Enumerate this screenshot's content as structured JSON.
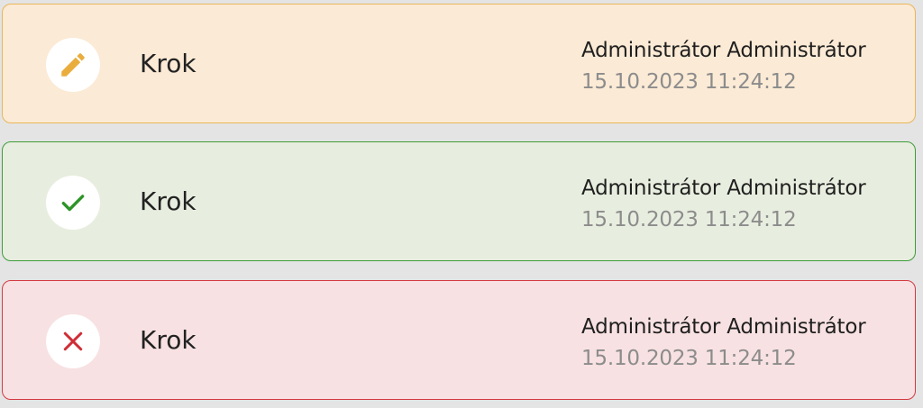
{
  "colors": {
    "page_background": "#e4e4e4",
    "edited": {
      "background": "#fbead5",
      "border": "#e8b65a",
      "icon": "#e9ad3e"
    },
    "approved": {
      "background": "#e8eedf",
      "border": "#3f9b3a",
      "icon": "#2e9428"
    },
    "rejected": {
      "background": "#f8e1e2",
      "border": "#d33a43",
      "icon": "#cf2d36"
    },
    "date_text": "#8c8c8c"
  },
  "steps": [
    {
      "status": "edited",
      "icon": "pencil-icon",
      "title": "Krok",
      "author": "Administrátor Administrátor",
      "datetime": "15.10.2023 11:24:12"
    },
    {
      "status": "approved",
      "icon": "checkmark-icon",
      "title": "Krok",
      "author": "Administrátor Administrátor",
      "datetime": "15.10.2023 11:24:12"
    },
    {
      "status": "rejected",
      "icon": "cross-icon",
      "title": "Krok",
      "author": "Administrátor Administrátor",
      "datetime": "15.10.2023 11:24:12"
    }
  ]
}
